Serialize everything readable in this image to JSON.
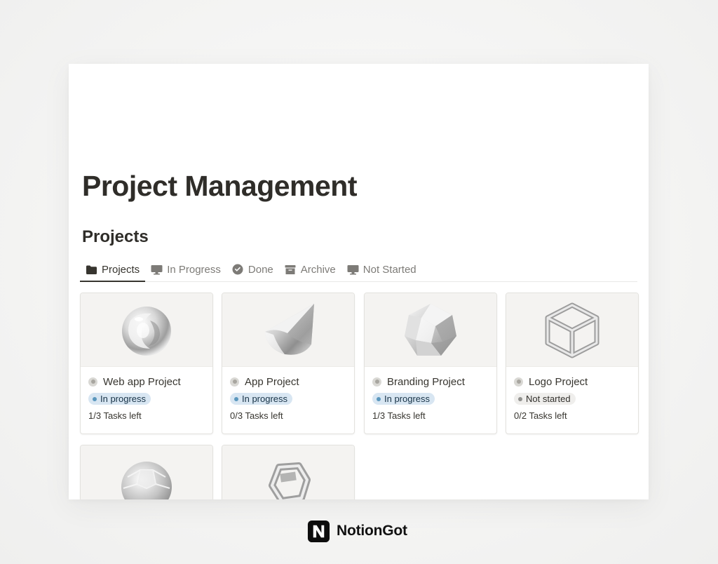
{
  "page": {
    "title": "Project Management",
    "section_heading": "Projects"
  },
  "tabs": [
    {
      "label": "Projects",
      "icon": "folder-icon",
      "active": true
    },
    {
      "label": "In Progress",
      "icon": "monitor-icon",
      "active": false
    },
    {
      "label": "Done",
      "icon": "check-circle-icon",
      "active": false
    },
    {
      "label": "Archive",
      "icon": "archive-box-icon",
      "active": false
    },
    {
      "label": "Not Started",
      "icon": "monitor-icon",
      "active": false
    }
  ],
  "cards": [
    {
      "title": "Web app Project",
      "status": "In progress",
      "tasks": "1/3 Tasks left",
      "cover_icon": "glass-sphere-icon"
    },
    {
      "title": "App Project",
      "status": "In progress",
      "tasks": "0/3 Tasks left",
      "cover_icon": "glass-cone-icon"
    },
    {
      "title": "Branding Project",
      "status": "In progress",
      "tasks": "1/3 Tasks left",
      "cover_icon": "glass-polyhedron-icon"
    },
    {
      "title": "Logo Project",
      "status": "Not started",
      "tasks": "0/2 Tasks left",
      "cover_icon": "glass-cube-frame-icon"
    },
    {
      "title": "",
      "status": "",
      "tasks": "",
      "cover_icon": "glass-faceted-ball-icon"
    },
    {
      "title": "",
      "status": "",
      "tasks": "",
      "cover_icon": "glass-ring-icon"
    }
  ],
  "status_colors": {
    "In progress": {
      "bg": "#d8e6f2",
      "dot": "#5b97bd",
      "text": "#183347"
    },
    "Not started": {
      "bg": "#efeeec",
      "dot": "#91918e",
      "text": "#32302c"
    }
  },
  "brand": {
    "name": "NotionGot",
    "icon": "notion-n-logo-icon"
  }
}
